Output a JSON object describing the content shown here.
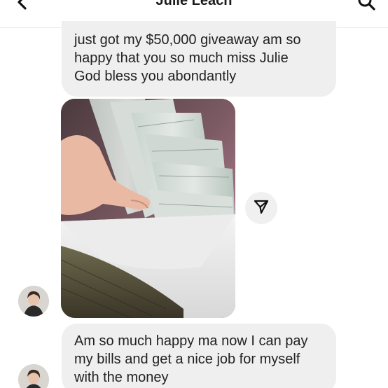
{
  "header": {
    "title": "Julie Leach",
    "back_icon": "chevron-left-icon",
    "search_icon": "search-icon"
  },
  "messages": [
    {
      "text_lines": [
        "just got my $50,000 giveaway am so",
        "happy that you so much miss Julie",
        "God bless you abondantly"
      ]
    },
    {
      "image": "photo-of-cash-in-envelope",
      "share_icon": "send-icon"
    },
    {
      "text_lines": [
        "Am so much happy ma now I can pay",
        "my bills and get a nice job for myself",
        "with the money"
      ]
    }
  ],
  "colors": {
    "bubble": "#efefef",
    "text": "#222222",
    "background": "#ffffff"
  }
}
